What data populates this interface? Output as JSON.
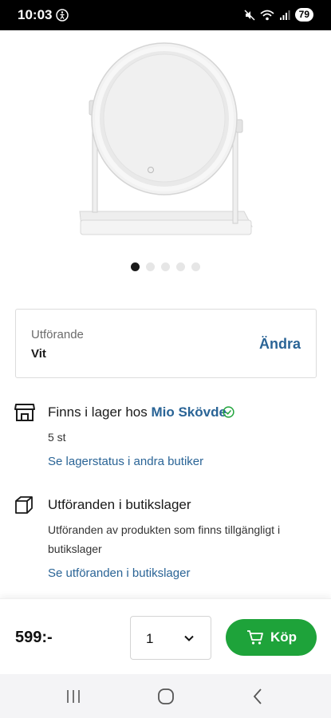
{
  "status_bar": {
    "time": "10:03",
    "battery": "79",
    "icons": [
      "accessibility-icon",
      "mute-icon",
      "wifi-icon",
      "signal-icon",
      "battery-icon"
    ]
  },
  "carousel": {
    "image": "white-round-led-mirror",
    "page_count": 5,
    "active_index": 0
  },
  "variant": {
    "label": "Utförande",
    "value": "Vit",
    "change_label": "Ändra"
  },
  "stock": {
    "icon": "store-icon",
    "prefix": "Finns i lager hos",
    "store": "Mio Skövde",
    "status_icon": "check-circle-icon",
    "count": "5 st",
    "link": "Se lagerstatus i andra butiker"
  },
  "store_variants": {
    "icon": "box-icon",
    "title": "Utföranden i butikslager",
    "description": "Utföranden av produkten som finns tillgängligt i butikslager",
    "link": "Se utföranden i butikslager"
  },
  "purchase": {
    "price": "599:-",
    "quantity": "1",
    "buy_label": "Köp",
    "buy_icon": "cart-icon"
  },
  "nav": [
    "recents-icon",
    "home-icon",
    "back-icon"
  ],
  "colors": {
    "link": "#2a6496",
    "buy": "#1ea33a",
    "check": "#1ea33a"
  }
}
